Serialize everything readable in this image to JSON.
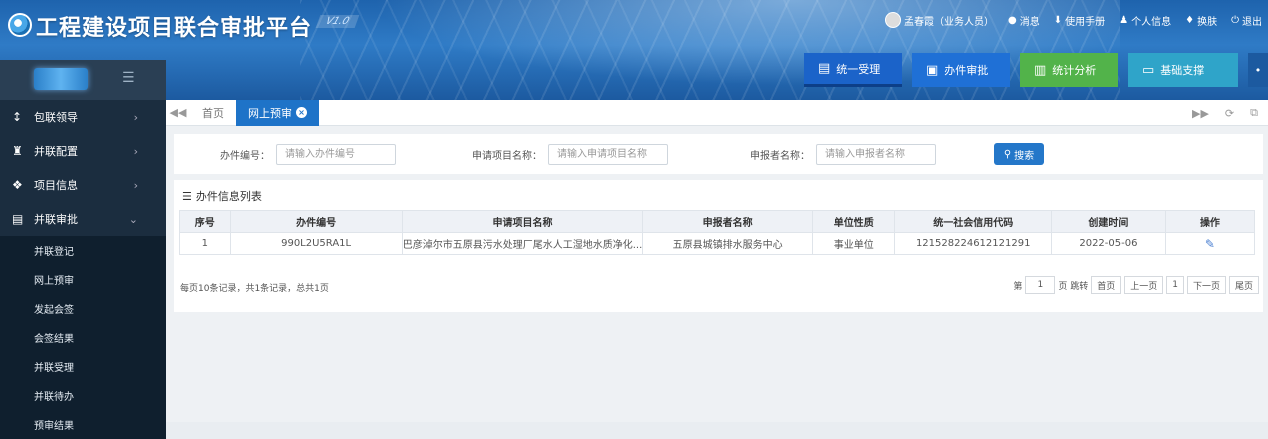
{
  "header": {
    "title": "工程建设项目联合审批平台",
    "version": "V1.0",
    "user": "孟春霞（业务人员）",
    "links": [
      {
        "icon": "chat-bubble-icon",
        "label": "消息"
      },
      {
        "icon": "download-icon",
        "label": "使用手册"
      },
      {
        "icon": "person-icon",
        "label": "个人信息"
      },
      {
        "icon": "shirt-icon",
        "label": "换肤"
      },
      {
        "icon": "power-icon",
        "label": "退出"
      }
    ],
    "nav": [
      "统一受理",
      "办件审批",
      "统计分析",
      "基础支撑"
    ]
  },
  "sidebar": {
    "items": [
      {
        "label": "包联领导",
        "icon": "arrow-up-icon"
      },
      {
        "label": "并联配置",
        "icon": "binoculars-icon"
      },
      {
        "label": "项目信息",
        "icon": "cubes-icon"
      },
      {
        "label": "并联审批",
        "icon": "document-edit-icon"
      }
    ],
    "sub_items": [
      "并联登记",
      "网上预审",
      "发起会签",
      "会签结果",
      "并联受理",
      "并联待办",
      "预审结果"
    ]
  },
  "tabs": {
    "items": [
      "首页",
      "网上预审"
    ],
    "active": "网上预审"
  },
  "search": {
    "fields": [
      {
        "label": "办件编号：",
        "placeholder": "请输入办件编号"
      },
      {
        "label": "申请项目名称：",
        "placeholder": "请输入申请项目名称"
      },
      {
        "label": "申报者名称：",
        "placeholder": "请输入申报者名称"
      }
    ],
    "button": "搜索"
  },
  "list": {
    "title": "办件信息列表",
    "columns": [
      "序号",
      "办件编号",
      "申请项目名称",
      "申报者名称",
      "单位性质",
      "统一社会信用代码",
      "创建时间",
      "操作"
    ],
    "rows": [
      [
        "1",
        "990L2U5RA1L",
        "巴彦淖尔市五原县污水处理厂尾水人工湿地水质净化...",
        "五原县城镇排水服务中心",
        "事业单位",
        "121528224612121291",
        "2022-05-06"
      ]
    ],
    "summary": "每页10条记录，共1条记录，总共1页",
    "pager": {
      "prefix": "第",
      "page": "1",
      "suffix": "页 跳转",
      "buttons": [
        "首页",
        "上一页",
        "1",
        "下一页",
        "尾页"
      ]
    }
  }
}
